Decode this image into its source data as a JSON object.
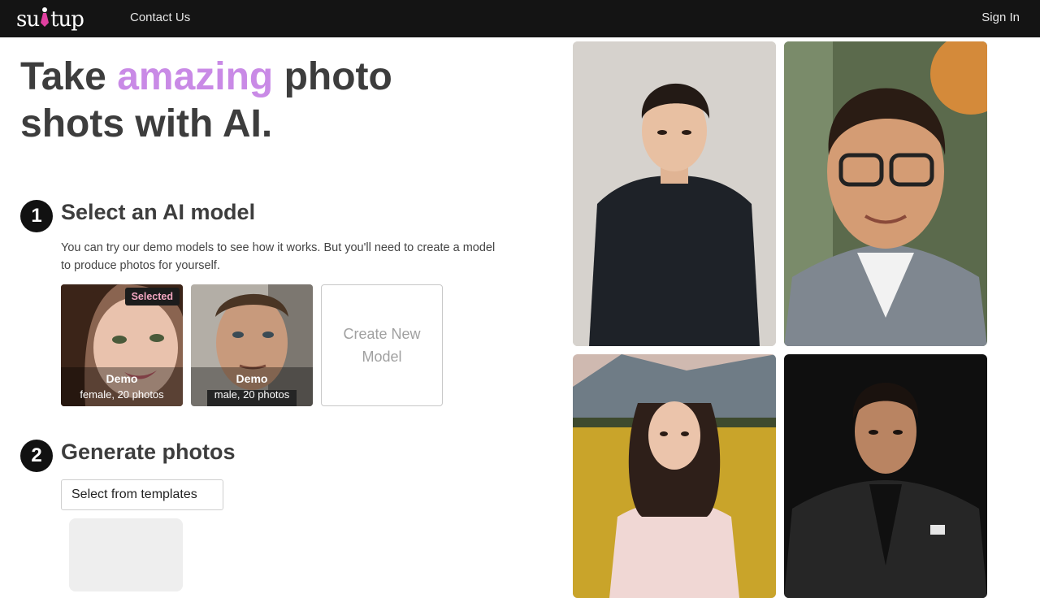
{
  "header": {
    "logo_text_left": "su",
    "logo_text_right": "tup",
    "contact_label": "Contact Us",
    "signin_label": "Sign In"
  },
  "hero": {
    "part1": "Take ",
    "accent": "amazing",
    "part2": " photo shots with AI.",
    "accent_color": "#c98ae6"
  },
  "step1": {
    "number": "1",
    "title": "Select an AI model",
    "description": "You can try our demo models to see how it works. But you'll need to create a model to produce photos for yourself.",
    "models": [
      {
        "name": "Demo",
        "meta": "female, 20 photos",
        "selected": true,
        "badge": "Selected"
      },
      {
        "name": "Demo",
        "meta": "male, 20 photos",
        "selected": false
      }
    ],
    "create_label": "Create New Model"
  },
  "step2": {
    "number": "2",
    "title": "Generate photos",
    "select_label": "Select from templates"
  },
  "gallery": {
    "photos": [
      "man-black-tshirt",
      "man-glasses-blazer",
      "woman-flower-field",
      "man-black-suit"
    ]
  }
}
